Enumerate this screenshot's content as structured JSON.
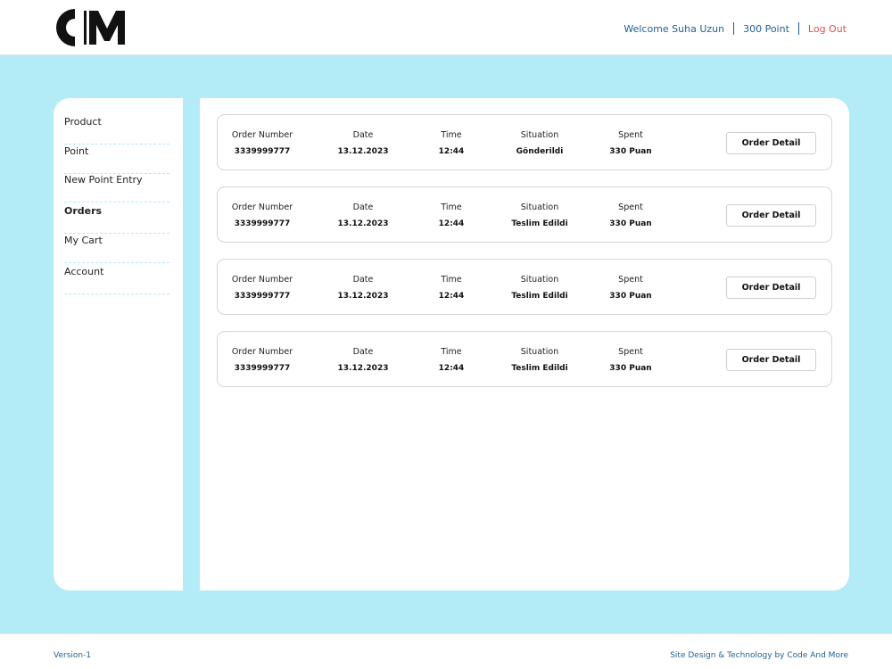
{
  "header": {
    "logo_text": "CM",
    "welcome": "Welcome Suha Uzun",
    "points": "300 Point",
    "logout": "Log Out"
  },
  "sidebar": {
    "items": [
      {
        "label": "Product"
      },
      {
        "label": "Point"
      },
      {
        "label": "New Point Entry"
      },
      {
        "label": "Orders",
        "active": true
      },
      {
        "label": "My Cart"
      },
      {
        "label": "Account"
      }
    ]
  },
  "orders": {
    "labels": {
      "order_number": "Order Number",
      "date": "Date",
      "time": "Time",
      "situation": "Situation",
      "spent": "Spent",
      "detail_button": "Order Detail"
    },
    "rows": [
      {
        "order_number": "3339999777",
        "date": "13.12.2023",
        "time": "12:44",
        "situation": "Gönderildi",
        "spent": "330 Puan"
      },
      {
        "order_number": "3339999777",
        "date": "13.12.2023",
        "time": "12:44",
        "situation": "Teslim Edildi",
        "spent": "330 Puan"
      },
      {
        "order_number": "3339999777",
        "date": "13.12.2023",
        "time": "12:44",
        "situation": "Teslim Edildi",
        "spent": "330 Puan"
      },
      {
        "order_number": "3339999777",
        "date": "13.12.2023",
        "time": "12:44",
        "situation": "Teslim Edildi",
        "spent": "330 Puan"
      }
    ]
  },
  "footer": {
    "version": "Version-1",
    "credit": "Site Design & Technology by Code And More"
  },
  "colors": {
    "background": "#b3ebf7",
    "link": "#1f5f93",
    "logout": "#d9534f"
  }
}
